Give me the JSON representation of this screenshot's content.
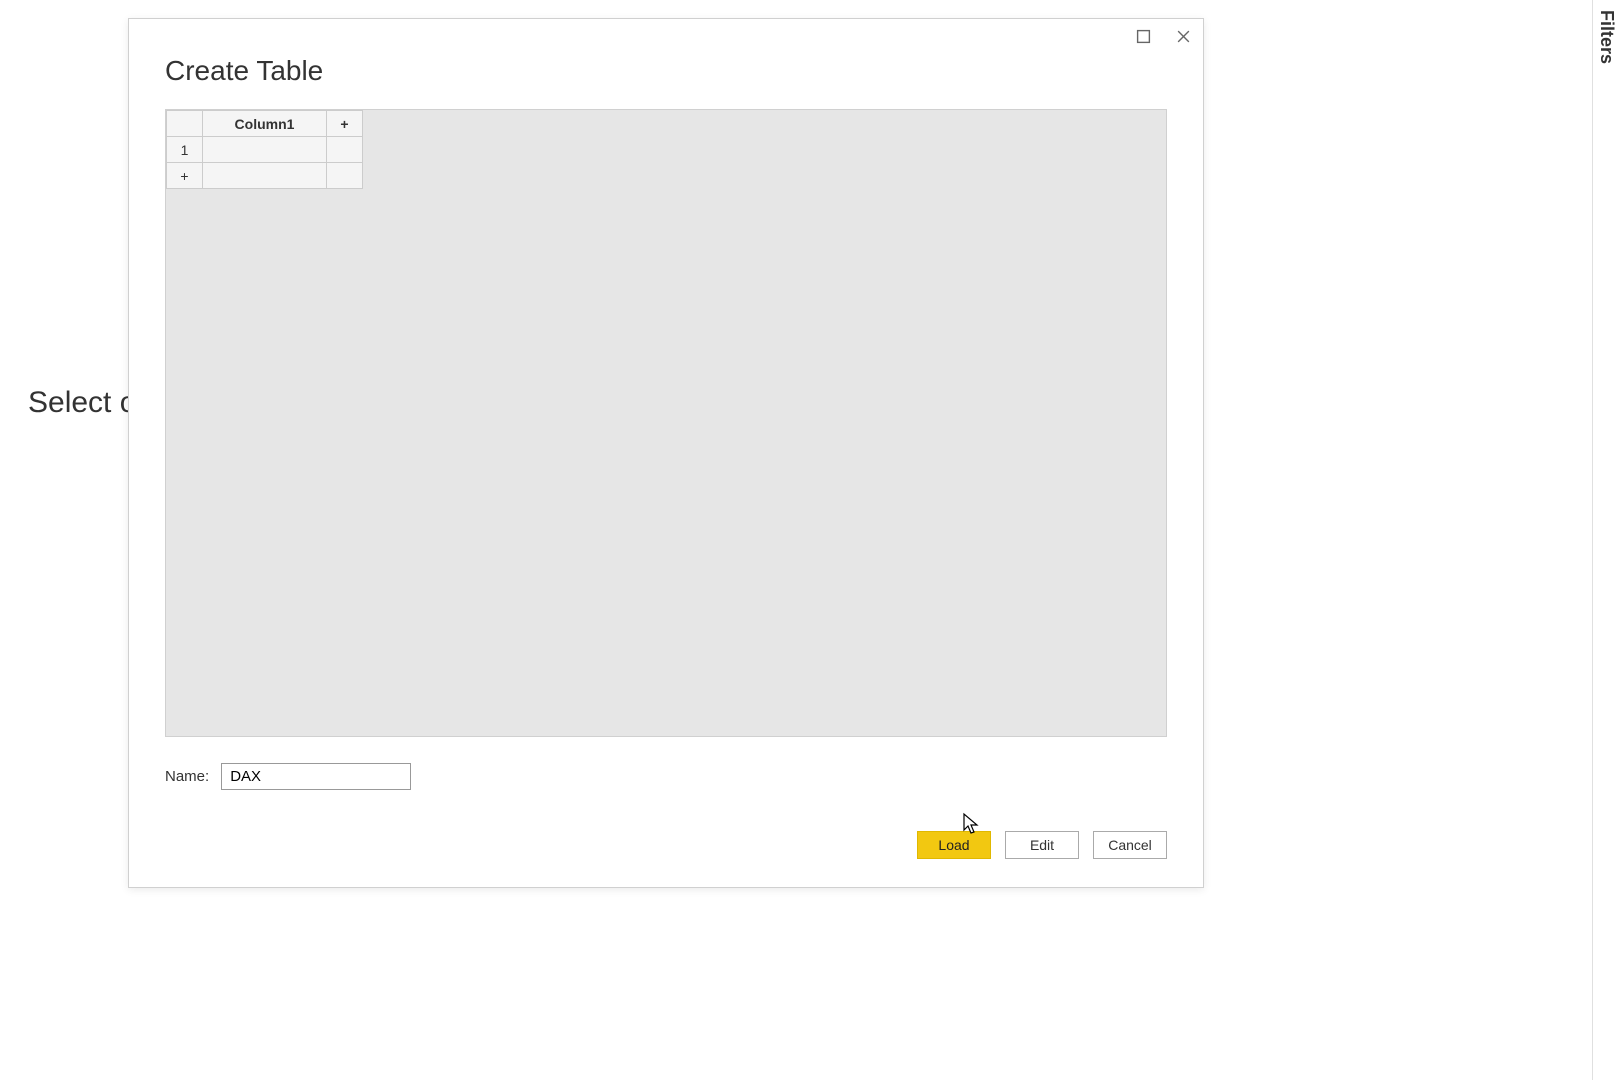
{
  "background": {
    "text": "Select o"
  },
  "filters": {
    "label": "Filters"
  },
  "dialog": {
    "title": "Create Table",
    "grid": {
      "column_header": "Column1",
      "row_number": "1",
      "add_col": "+",
      "add_row": "+"
    },
    "name_label": "Name:",
    "name_value": "DAX",
    "buttons": {
      "load": "Load",
      "edit": "Edit",
      "cancel": "Cancel"
    }
  }
}
